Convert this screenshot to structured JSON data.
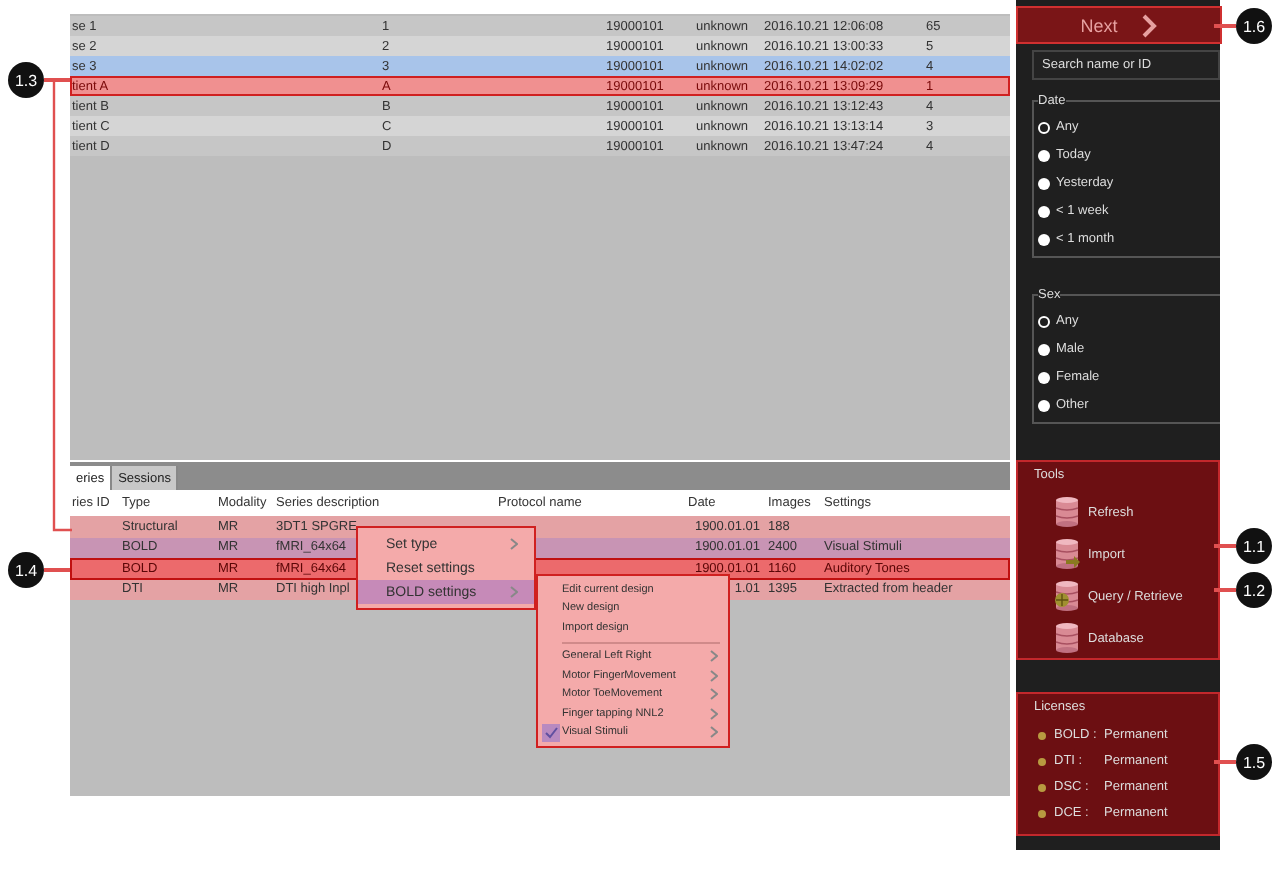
{
  "results": {
    "rows": [
      {
        "cells": [
          "se 1",
          "1",
          "19000101",
          "unknown",
          "2016.10.21 12:06:08",
          "65"
        ],
        "selected": false,
        "highlighted": false
      },
      {
        "cells": [
          "se 2",
          "2",
          "19000101",
          "unknown",
          "2016.10.21 13:00:33",
          "5"
        ],
        "selected": false,
        "highlighted": false
      },
      {
        "cells": [
          "se 3",
          "3",
          "19000101",
          "unknown",
          "2016.10.21 14:02:02",
          "4"
        ],
        "selected": true,
        "highlighted": false
      },
      {
        "cells": [
          "tient A",
          "A",
          "19000101",
          "unknown",
          "2016.10.21 13:09:29",
          "1"
        ],
        "selected": false,
        "highlighted": true
      },
      {
        "cells": [
          "tient B",
          "B",
          "19000101",
          "unknown",
          "2016.10.21 13:12:43",
          "4"
        ],
        "selected": false,
        "highlighted": false
      },
      {
        "cells": [
          "tient C",
          "C",
          "19000101",
          "unknown",
          "2016.10.21 13:13:14",
          "3"
        ],
        "selected": false,
        "highlighted": false
      },
      {
        "cells": [
          "tient D",
          "D",
          "19000101",
          "unknown",
          "2016.10.21 13:47:24",
          "4"
        ],
        "selected": false,
        "highlighted": false
      }
    ]
  },
  "tabs": [
    {
      "label": "eries",
      "selected": true
    },
    {
      "label": "Sessions",
      "selected": false
    }
  ],
  "series": {
    "columns": [
      "ries ID",
      "Type",
      "Modality",
      "Series description",
      "Protocol name",
      "Date",
      "Images",
      "Settings"
    ],
    "rows": [
      {
        "cells": [
          "",
          "Structural",
          "MR",
          "3DT1 SPGRE",
          "",
          "1900.01.01",
          "188",
          ""
        ],
        "selected": false,
        "highlighted": false
      },
      {
        "cells": [
          "",
          "BOLD",
          "MR",
          "fMRI_64x64",
          "",
          "1900.01.01",
          "2400",
          "Visual Stimuli"
        ],
        "selected": true,
        "highlighted": false
      },
      {
        "cells": [
          "",
          "BOLD",
          "MR",
          "fMRI_64x64",
          "",
          "1900.01.01",
          "1160",
          "Auditory Tones"
        ],
        "selected": false,
        "highlighted": true
      },
      {
        "cells": [
          "",
          "DTI",
          "MR",
          "DTI high Inpl",
          "",
          "1.01",
          "1395",
          "Extracted from header"
        ],
        "selected": false,
        "highlighted": false
      }
    ]
  },
  "context_menu": {
    "items": [
      {
        "label": "Set type",
        "has_submenu": true,
        "selected": false
      },
      {
        "label": "Reset settings",
        "has_submenu": false,
        "selected": false
      },
      {
        "label": "BOLD settings",
        "has_submenu": true,
        "selected": true
      }
    ]
  },
  "submenu": {
    "actions": [
      "Edit current design",
      "New design",
      "Import design"
    ],
    "designs": [
      {
        "label": "General Left Right",
        "checked": false
      },
      {
        "label": "Motor FingerMovement",
        "checked": false
      },
      {
        "label": "Motor ToeMovement",
        "checked": false
      },
      {
        "label": "Finger tapping NNL2",
        "checked": false
      },
      {
        "label": "Visual Stimuli",
        "checked": true
      }
    ]
  },
  "sidebar": {
    "next_button": "Next",
    "search": {
      "placeholder": "Search name or ID"
    },
    "filters": [
      {
        "title": "Date",
        "options": [
          {
            "label": "Any",
            "selected": true
          },
          {
            "label": "Today",
            "selected": false
          },
          {
            "label": "Yesterday",
            "selected": false
          },
          {
            "label": "< 1 week",
            "selected": false
          },
          {
            "label": "< 1 month",
            "selected": false
          }
        ]
      },
      {
        "title": "Sex",
        "options": [
          {
            "label": "Any",
            "selected": true
          },
          {
            "label": "Male",
            "selected": false
          },
          {
            "label": "Female",
            "selected": false
          },
          {
            "label": "Other",
            "selected": false
          }
        ]
      }
    ],
    "tools": {
      "title": "Tools",
      "items": [
        {
          "label": "Refresh",
          "kind": "plain"
        },
        {
          "label": "Import",
          "kind": "import"
        },
        {
          "label": "Query / Retrieve",
          "kind": "query"
        },
        {
          "label": "Database",
          "kind": "plain"
        }
      ]
    },
    "licenses": {
      "title": "Licenses",
      "items": [
        {
          "name": "BOLD :",
          "status": "Permanent"
        },
        {
          "name": "DTI :",
          "status": "Permanent"
        },
        {
          "name": "DSC :",
          "status": "Permanent"
        },
        {
          "name": "DCE :",
          "status": "Permanent"
        }
      ]
    }
  },
  "callouts": [
    {
      "label": "1.6"
    },
    {
      "label": "1.3"
    },
    {
      "label": "1.4"
    },
    {
      "label": "1.1"
    },
    {
      "label": "1.2"
    },
    {
      "label": "1.5"
    }
  ]
}
